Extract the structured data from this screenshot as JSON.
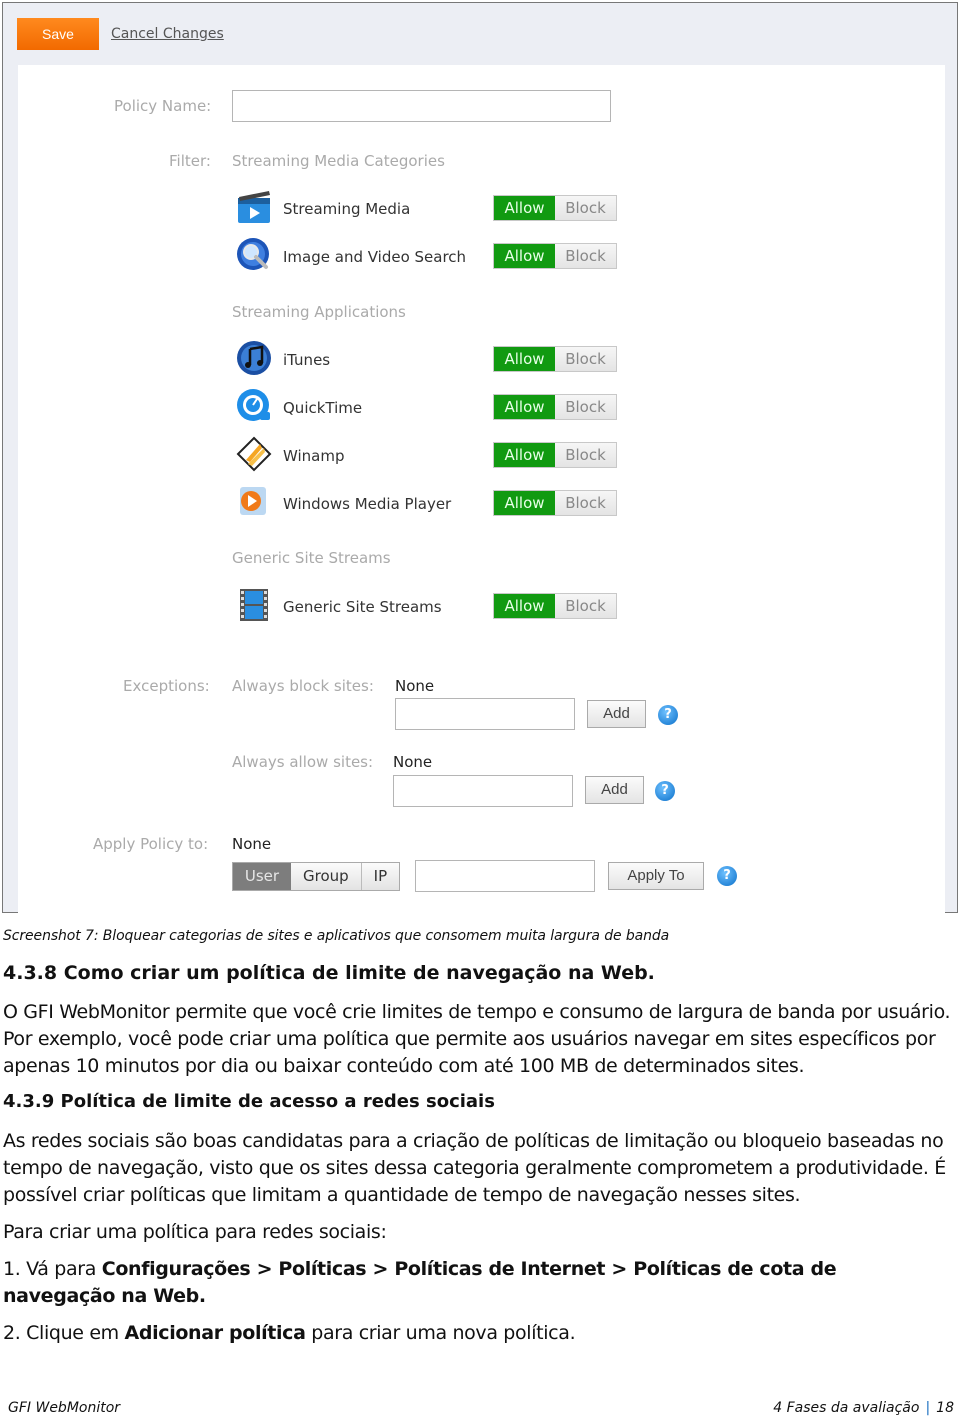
{
  "screenshot": {
    "toolbar": {
      "save_label": "Save",
      "cancel_label": "Cancel Changes"
    },
    "policy_name": {
      "label": "Policy Name:",
      "value": ""
    },
    "filter": {
      "label": "Filter:",
      "groups": [
        {
          "title": "Streaming Media Categories",
          "items": [
            {
              "label": "Streaming Media",
              "icon": "streaming-media-icon",
              "state": "Allow"
            },
            {
              "label": "Image and Video Search",
              "icon": "image-video-search-icon",
              "state": "Allow"
            }
          ]
        },
        {
          "title": "Streaming Applications",
          "items": [
            {
              "label": "iTunes",
              "icon": "itunes-icon",
              "state": "Allow"
            },
            {
              "label": "QuickTime",
              "icon": "quicktime-icon",
              "state": "Allow"
            },
            {
              "label": "Winamp",
              "icon": "winamp-icon",
              "state": "Allow"
            },
            {
              "label": "Windows Media Player",
              "icon": "windows-media-player-icon",
              "state": "Allow"
            }
          ]
        },
        {
          "title": "Generic Site Streams",
          "items": [
            {
              "label": "Generic Site Streams",
              "icon": "film-strip-icon",
              "state": "Allow"
            }
          ]
        }
      ],
      "allow_label": "Allow",
      "block_label": "Block"
    },
    "exceptions": {
      "label": "Exceptions:",
      "always_block": {
        "label": "Always block sites:",
        "value": "None",
        "input": "",
        "add_label": "Add"
      },
      "always_allow": {
        "label": "Always allow sites:",
        "value": "None",
        "input": "",
        "add_label": "Add"
      }
    },
    "apply_policy": {
      "label": "Apply Policy to:",
      "value": "None",
      "segments": [
        "User",
        "Group",
        "IP"
      ],
      "active_segment": "User",
      "input": "",
      "apply_label": "Apply To"
    },
    "help_glyph": "?"
  },
  "document": {
    "caption": "Screenshot 7: Bloquear categorias de sites e aplicativos que consomem muita largura de banda",
    "section_438": {
      "heading": "4.3.8 Como criar um política de limite de navegação na Web.",
      "paragraph": "O GFI WebMonitor permite que você crie limites de tempo e consumo de largura de banda por usuário. Por exemplo, você pode criar uma política que permite aos usuários navegar em sites específicos por apenas 10 minutos por dia ou baixar conteúdo com até 100 MB de determinados sites."
    },
    "section_439": {
      "heading": "4.3.9 Política de limite de acesso a redes sociais",
      "paragraph": "As redes sociais são boas candidatas para a criação de políticas de limitação ou bloqueio baseadas no tempo de navegação, visto que os sites dessa categoria geralmente comprometem a produtividade. É possível criar políticas que limitam a quantidade de tempo de navegação nesses sites.",
      "intro": "Para criar uma política para redes sociais:",
      "step1_prefix": "1. Vá para ",
      "step1_path": "Configurações > Políticas > Políticas de Internet > Políticas de cota de navegação na Web.",
      "step2_prefix": "2. Clique em ",
      "step2_action": "Adicionar política",
      "step2_suffix": " para criar uma nova política."
    }
  },
  "footer": {
    "product": "GFI WebMonitor",
    "chapter": "4 Fases da avaliação",
    "separator": "|",
    "page": "18"
  },
  "colors": {
    "save_orange": "#f26a00",
    "allow_green": "#119a11",
    "link_blue": "#1a6fc0",
    "frame_bg": "#eceef4"
  }
}
